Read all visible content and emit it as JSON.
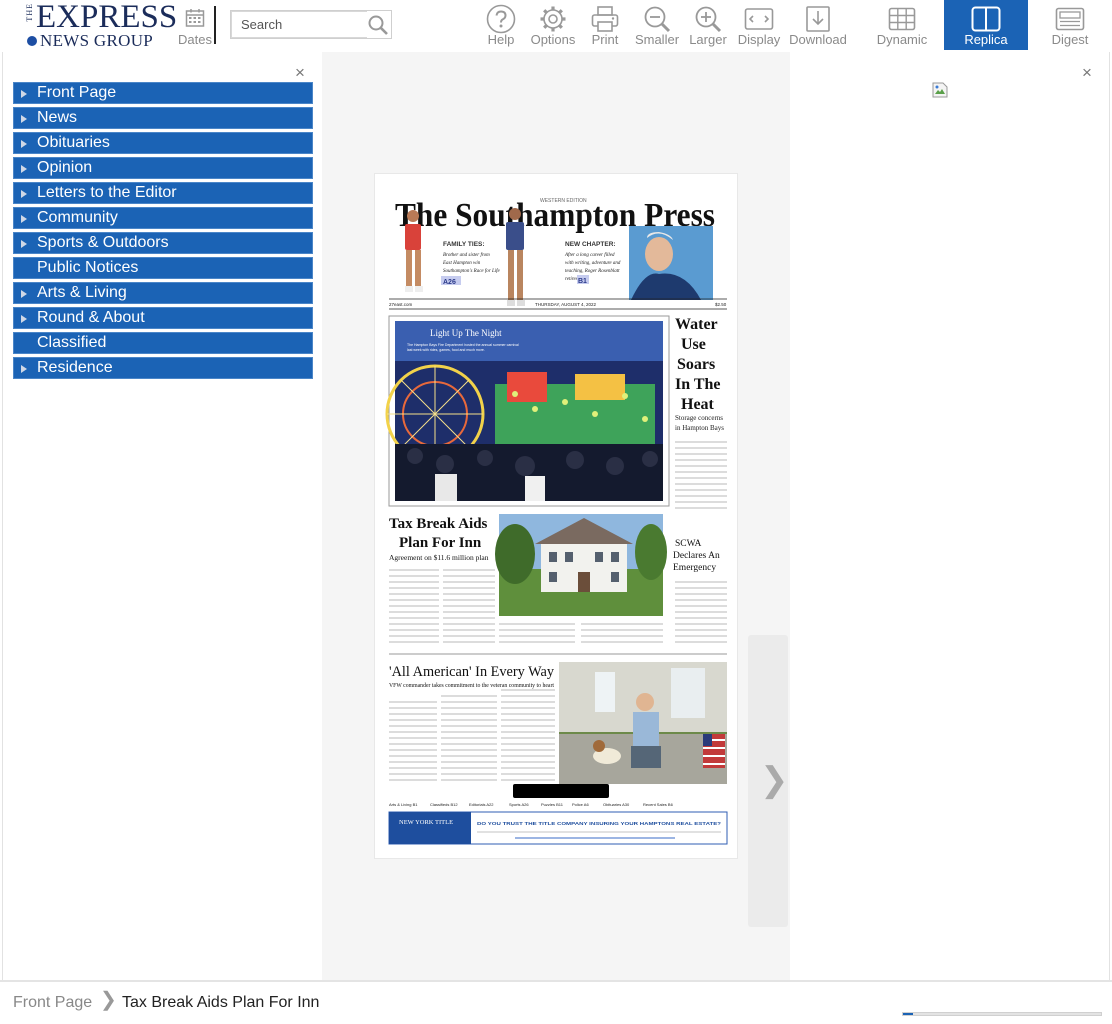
{
  "logo": {
    "the": "THE",
    "express": "EXPRESS",
    "news_group": "NEWS GROUP"
  },
  "toolbar": {
    "dates_label": "Dates",
    "search_placeholder": "Search",
    "buttons": [
      {
        "id": "help",
        "label": "Help",
        "icon": "question-circle-icon"
      },
      {
        "id": "options",
        "label": "Options",
        "icon": "gear-icon"
      },
      {
        "id": "print",
        "label": "Print",
        "icon": "printer-icon"
      },
      {
        "id": "smaller",
        "label": "Smaller",
        "icon": "zoom-out-icon"
      },
      {
        "id": "larger",
        "label": "Larger",
        "icon": "zoom-in-icon"
      },
      {
        "id": "display",
        "label": "Display",
        "icon": "display-icon"
      },
      {
        "id": "download",
        "label": "Download",
        "icon": "download-icon"
      }
    ],
    "views": [
      {
        "id": "dynamic",
        "label": "Dynamic",
        "icon": "grid-icon",
        "active": false
      },
      {
        "id": "replica",
        "label": "Replica",
        "icon": "open-book-icon",
        "active": true
      },
      {
        "id": "digest",
        "label": "Digest",
        "icon": "list-icon",
        "active": false
      }
    ]
  },
  "nav": {
    "close": "×",
    "items": [
      {
        "label": "Front Page",
        "has_arrow": true
      },
      {
        "label": "News",
        "has_arrow": true
      },
      {
        "label": "Obituaries",
        "has_arrow": true
      },
      {
        "label": "Opinion",
        "has_arrow": true
      },
      {
        "label": "Letters to the Editor",
        "has_arrow": true
      },
      {
        "label": "Community",
        "has_arrow": true
      },
      {
        "label": "Sports & Outdoors",
        "has_arrow": true
      },
      {
        "label": "Public Notices",
        "has_arrow": false
      },
      {
        "label": "Arts & Living",
        "has_arrow": true
      },
      {
        "label": "Round & About",
        "has_arrow": true
      },
      {
        "label": "Classified",
        "has_arrow": false
      },
      {
        "label": "Residence",
        "has_arrow": true
      }
    ]
  },
  "newspaper": {
    "edition": "WESTERN EDITION",
    "masthead": "The Southampton Press",
    "teaser_left_title": "FAMILY TIES:",
    "teaser_left_text": "Brother and sister from East Hampton win Southampton Fresh Air Home's Race for Life",
    "teaser_left_page": "A26",
    "teaser_right_title": "NEW CHAPTER:",
    "teaser_right_text": "After a long career filled with writing, adventure and teaching, Roger Rosenblatt retires",
    "teaser_right_page": "B1",
    "dateline_left": "27east.com",
    "dateline_center": "THURSDAY, AUGUST 4, 2022",
    "dateline_right": "$2.50",
    "photo_headline": "Light Up The Night",
    "photo_caption": "The Hampton Bays Fire Department hosted the annual summer carnival last week with rides, games, food and much more.",
    "side_headline": "Water Use Soars In The Heat",
    "side_sub": "Storage concerns in Hampton Bays",
    "story2_headline": "Tax Break Aids Plan For Inn",
    "story2_deck": "Agreement on $11.6 million plan",
    "side2_headline": "SCWA Declares An Emergency",
    "story3_headline": "'All American' In Every Way",
    "story3_deck": "VFW commander takes commitment to the veteran community to heart",
    "index": [
      "Arts & Living B1",
      "Classifieds B12",
      "Editorials A22",
      "Sports A26",
      "Puzzles B11",
      "Police A6",
      "Obituaries A30",
      "Recent Sales B6"
    ],
    "ad_brand": "NEW YORK TITLE",
    "ad_headline": "DO YOU TRUST THE TITLE COMPANY INSURING YOUR HAMPTONS REAL ESTATE?"
  },
  "right_panel": {
    "close": "×"
  },
  "breadcrumb": {
    "root": "Front Page",
    "separator": "❯",
    "current": "Tax Break Aids Plan For Inn"
  },
  "progress": {
    "fraction": 0.05
  },
  "colors": {
    "accent": "#1b63b5",
    "logo_navy": "#1b2c5a"
  }
}
